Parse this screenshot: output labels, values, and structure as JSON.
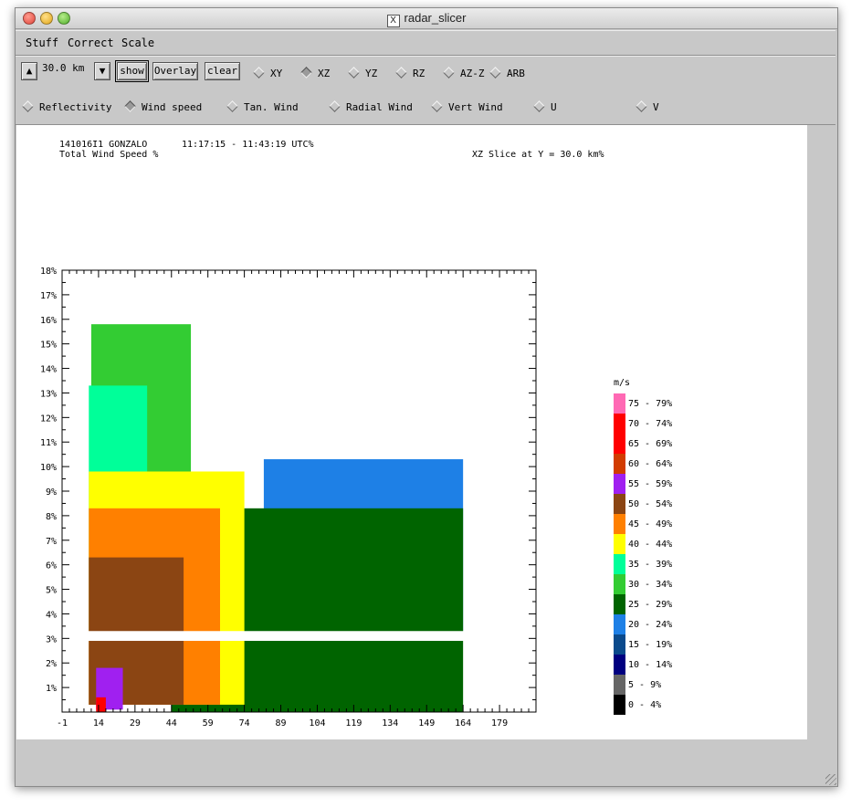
{
  "window": {
    "title": "radar_slicer"
  },
  "menu": [
    "Stuff",
    "Correct",
    "Scale"
  ],
  "toolbar": {
    "up_arrow": "▲",
    "down_arrow": "▼",
    "distance": "30.0 km",
    "show_label": "show",
    "overlay_label": "Overlay",
    "clear_label": "clear",
    "slice_modes": [
      {
        "label": "XY",
        "selected": false
      },
      {
        "label": "XZ",
        "selected": true
      },
      {
        "label": "YZ",
        "selected": false
      },
      {
        "label": "RZ",
        "selected": false
      },
      {
        "label": "AZ-Z",
        "selected": false
      },
      {
        "label": "ARB",
        "selected": false
      }
    ],
    "fields": [
      {
        "label": "Reflectivity",
        "selected": false
      },
      {
        "label": "Wind speed",
        "selected": true
      },
      {
        "label": "Tan. Wind",
        "selected": false
      },
      {
        "label": "Radial Wind",
        "selected": false
      },
      {
        "label": "Vert Wind",
        "selected": false
      },
      {
        "label": "U",
        "selected": false
      },
      {
        "label": "V",
        "selected": false
      }
    ]
  },
  "plot_header": {
    "id_storm": "141016I1 GONZALO",
    "time_range": "11:17:15 - 11:43:19 UTC%",
    "field": "Total Wind Speed %",
    "slice": "XZ Slice at Y = 30.0 km%"
  },
  "chart_data": {
    "type": "heatmap",
    "x_ticks": [
      "-1",
      "14",
      "29",
      "44",
      "59",
      "74",
      "89",
      "104",
      "119",
      "134",
      "149",
      "164",
      "179"
    ],
    "y_ticks": [
      "1%",
      "2%",
      "3%",
      "4%",
      "5%",
      "6%",
      "7%",
      "8%",
      "9%",
      "10%",
      "11%",
      "12%",
      "13%",
      "14%",
      "15%",
      "16%",
      "17%",
      "18%"
    ],
    "xlim": [
      -1,
      194
    ],
    "ylim": [
      0,
      18
    ],
    "legend_unit": "m/s",
    "legend": [
      {
        "label": "75 - 79%",
        "color": "#ff69b4"
      },
      {
        "label": "70 - 74%",
        "color": "#ff0000"
      },
      {
        "label": "65 - 69%",
        "color": "#ff0000"
      },
      {
        "label": "60 - 64%",
        "color": "#d23c00"
      },
      {
        "label": "55 - 59%",
        "color": "#a020f0"
      },
      {
        "label": "50 - 54%",
        "color": "#8b4513"
      },
      {
        "label": "45 - 49%",
        "color": "#ff8000"
      },
      {
        "label": "40 - 44%",
        "color": "#ffff00"
      },
      {
        "label": "35 - 39%",
        "color": "#00ff99"
      },
      {
        "label": "30 - 34%",
        "color": "#33cc33"
      },
      {
        "label": "25 - 29%",
        "color": "#006400"
      },
      {
        "label": "20 - 24%",
        "color": "#1e80e6"
      },
      {
        "label": "15 - 19%",
        "color": "#0a4a8c"
      },
      {
        "label": "10 - 14%",
        "color": "#000080"
      },
      {
        "label": "5 - 9%",
        "color": "#666666"
      },
      {
        "label": "0 - 4%",
        "color": "#000000"
      }
    ],
    "regions": [
      {
        "band": "20 - 24%",
        "x": [
          82,
          164
        ],
        "y": [
          3.3,
          10.3
        ]
      },
      {
        "band": "25 - 29%",
        "x": [
          44,
          164
        ],
        "y": [
          0.0,
          8.3
        ]
      },
      {
        "band": "30 - 34%",
        "x": [
          11,
          52
        ],
        "y": [
          3.3,
          15.8
        ]
      },
      {
        "band": "35 - 39%",
        "x": [
          10,
          34
        ],
        "y": [
          3.3,
          13.3
        ]
      },
      {
        "band": "40 - 44%",
        "x": [
          10,
          74
        ],
        "y": [
          0.3,
          9.8
        ]
      },
      {
        "band": "45 - 49%",
        "x": [
          10,
          64
        ],
        "y": [
          0.3,
          8.3
        ]
      },
      {
        "band": "50 - 54%",
        "x": [
          10,
          49
        ],
        "y": [
          0.3,
          6.3
        ]
      },
      {
        "band": "55 - 59%",
        "x": [
          13,
          24
        ],
        "y": [
          0.1,
          1.8
        ]
      },
      {
        "band": "65 - 69%",
        "x": [
          13,
          17
        ],
        "y": [
          0.0,
          0.6
        ]
      }
    ]
  }
}
